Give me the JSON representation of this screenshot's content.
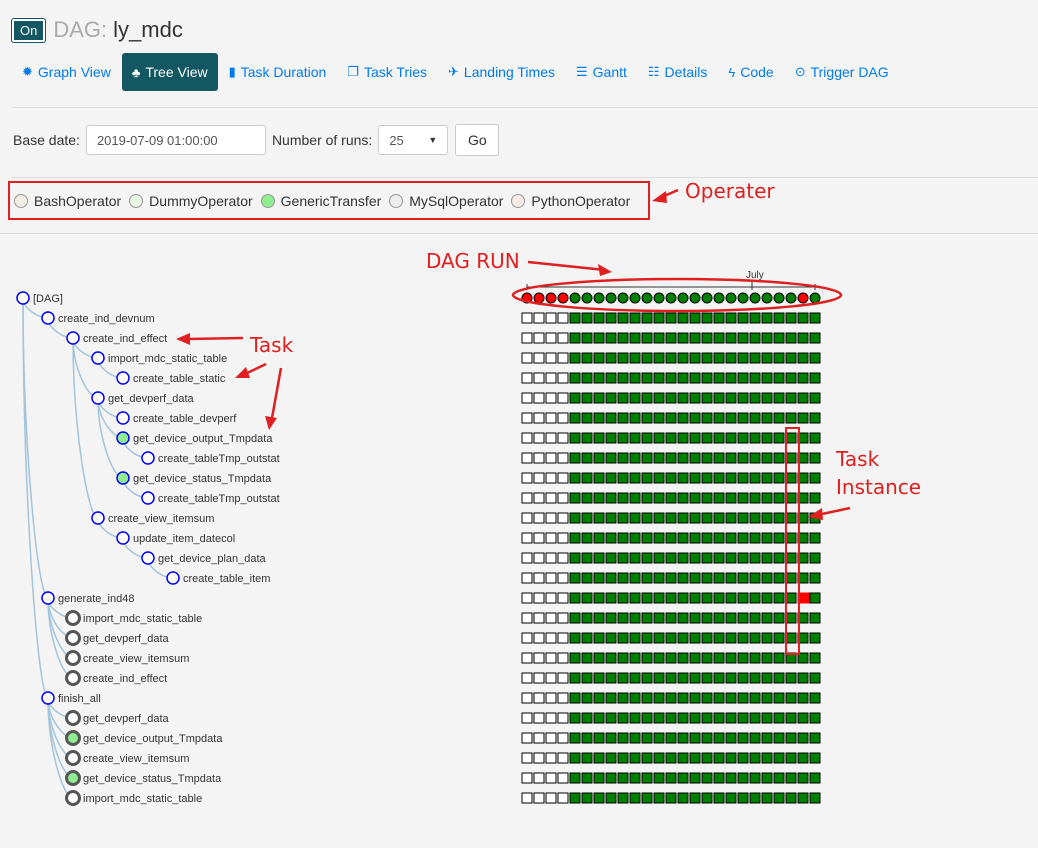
{
  "header": {
    "toggle_label": "On",
    "dag_prefix": "DAG:",
    "dag_id": "ly_mdc"
  },
  "nav": [
    {
      "label": "Graph View",
      "icon": "asterisk-icon",
      "glyph": "✹",
      "active": false
    },
    {
      "label": "Tree View",
      "icon": "tree-icon",
      "glyph": "♣",
      "active": true
    },
    {
      "label": "Task Duration",
      "icon": "bar-chart-icon",
      "glyph": "▮",
      "active": false
    },
    {
      "label": "Task Tries",
      "icon": "duplicate-icon",
      "glyph": "❐",
      "active": false
    },
    {
      "label": "Landing Times",
      "icon": "plane-icon",
      "glyph": "✈",
      "active": false
    },
    {
      "label": "Gantt",
      "icon": "align-left-icon",
      "glyph": "☰",
      "active": false
    },
    {
      "label": "Details",
      "icon": "list-icon",
      "glyph": "☷",
      "active": false
    },
    {
      "label": "Code",
      "icon": "flash-icon",
      "glyph": "ϟ",
      "active": false
    },
    {
      "label": "Trigger DAG",
      "icon": "play-circle-icon",
      "glyph": "⊙",
      "active": false
    }
  ],
  "controls": {
    "base_date_label": "Base date:",
    "base_date_value": "2019-07-09 01:00:00",
    "runs_label": "Number of runs:",
    "runs_value": "25",
    "go_label": "Go"
  },
  "legend": [
    {
      "name": "BashOperator",
      "color": "#f0ede4"
    },
    {
      "name": "DummyOperator",
      "color": "#e8f7e4"
    },
    {
      "name": "GenericTransfer",
      "color": "#90ee90"
    },
    {
      "name": "MySqlOperator",
      "color": "#ededed"
    },
    {
      "name": "PythonOperator",
      "color": "#f6ebe8"
    }
  ],
  "annotations": {
    "operator": "Operater",
    "dag_run": "DAG RUN",
    "task": "Task",
    "task_instance_line1": "Task",
    "task_instance_line2": "Instance"
  },
  "timeline": {
    "month_label": "July"
  },
  "dag_runs": [
    "failed",
    "failed",
    "failed",
    "failed",
    "success",
    "success",
    "success",
    "success",
    "success",
    "success",
    "success",
    "success",
    "success",
    "success",
    "success",
    "success",
    "success",
    "success",
    "success",
    "success",
    "success",
    "success",
    "success",
    "failed",
    "success"
  ],
  "state_colors": {
    "success": "#008000",
    "failed": "#ff0000",
    "none": "#ffffff"
  },
  "tree": [
    {
      "label": "[DAG]",
      "depth": 0,
      "style": "blue",
      "grid": "run"
    },
    {
      "label": "create_ind_devnum",
      "depth": 1,
      "style": "blue"
    },
    {
      "label": "create_ind_effect",
      "depth": 2,
      "style": "blue"
    },
    {
      "label": "import_mdc_static_table",
      "depth": 3,
      "style": "blue"
    },
    {
      "label": "create_table_static",
      "depth": 4,
      "style": "blue"
    },
    {
      "label": "get_devperf_data",
      "depth": 3,
      "style": "blue"
    },
    {
      "label": "create_table_devperf",
      "depth": 4,
      "style": "blue"
    },
    {
      "label": "get_device_output_Tmpdata",
      "depth": 4,
      "style": "green"
    },
    {
      "label": "create_tableTmp_outstat",
      "depth": 5,
      "style": "blue"
    },
    {
      "label": "get_device_status_Tmpdata",
      "depth": 4,
      "style": "green"
    },
    {
      "label": "create_tableTmp_outstat",
      "depth": 5,
      "style": "blue"
    },
    {
      "label": "create_view_itemsum",
      "depth": 3,
      "style": "blue"
    },
    {
      "label": "update_item_datecol",
      "depth": 4,
      "style": "blue"
    },
    {
      "label": "get_device_plan_data",
      "depth": 5,
      "style": "blue"
    },
    {
      "label": "create_table_item",
      "depth": 6,
      "style": "blue"
    },
    {
      "label": "generate_ind48",
      "depth": 1,
      "style": "blue"
    },
    {
      "label": "import_mdc_static_table",
      "depth": 2,
      "style": "dark"
    },
    {
      "label": "get_devperf_data",
      "depth": 2,
      "style": "dark"
    },
    {
      "label": "create_view_itemsum",
      "depth": 2,
      "style": "dark"
    },
    {
      "label": "create_ind_effect",
      "depth": 2,
      "style": "dark"
    },
    {
      "label": "finish_all",
      "depth": 1,
      "style": "blue"
    },
    {
      "label": "get_devperf_data",
      "depth": 2,
      "style": "dark"
    },
    {
      "label": "get_device_output_Tmpdata",
      "depth": 2,
      "style": "dark-green"
    },
    {
      "label": "create_view_itemsum",
      "depth": 2,
      "style": "dark"
    },
    {
      "label": "get_device_status_Tmpdata",
      "depth": 2,
      "style": "dark-green"
    },
    {
      "label": "import_mdc_static_table",
      "depth": 2,
      "style": "dark"
    }
  ],
  "task_grid_pattern": {
    "blank_runs": 4,
    "total_runs": 25,
    "failed_cells": [
      {
        "row": 15,
        "run": 23
      }
    ]
  }
}
